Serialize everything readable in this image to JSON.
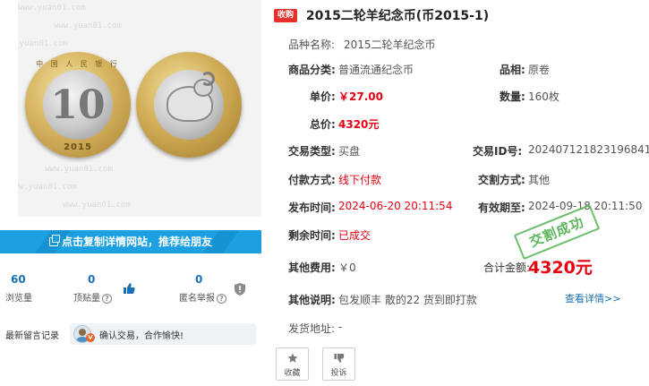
{
  "listing": {
    "badge": "收购",
    "title": "2015二轮羊纪念币(币2015-1)"
  },
  "fields": {
    "variety_label": "品种名称:",
    "variety_value": "2015二轮羊纪念币",
    "category_label": "商品分类:",
    "category_value": "普通流通纪念币",
    "grade_label": "品相:",
    "grade_value": "原卷",
    "unit_price_label": "单价:",
    "unit_price_value": "￥27.00",
    "quantity_label": "数量:",
    "quantity_value": "160枚",
    "total_label": "总价:",
    "total_value": "4320元",
    "trade_type_label": "交易类型:",
    "trade_type_value": "买盘",
    "trade_id_label": "交易ID号:",
    "trade_id_value": "202407121823196841",
    "payment_label": "付款方式:",
    "payment_value": "线下付款",
    "delivery_method_label": "交割方式:",
    "delivery_method_value": "其他",
    "published_label": "发布时间:",
    "published_value": "2024-06-20 20:11:54",
    "expires_label": "有效期至:",
    "expires_value": "2024-09-18 20:11:50",
    "remaining_label": "剩余时间:",
    "remaining_value": "已成交",
    "other_fees_label": "其他费用:",
    "other_fees_value": "￥0",
    "grand_total_label": "合计金额:",
    "grand_total_value": "4320元",
    "notes_label": "其他说明:",
    "notes_value": "包发顺丰 散的22 货到即打款",
    "notes_link": "查看详情>>",
    "shipping_address_label": "发货地址:",
    "shipping_address_value": "-"
  },
  "stamp_text": "交割成功",
  "actions": {
    "favorite_label": "收藏",
    "report_label": "投诉"
  },
  "left_panel": {
    "share_label": "点击复制详情网站，推荐给朋友",
    "stats": {
      "views_value": "60",
      "views_label": "浏览量",
      "likes_value": "0",
      "likes_label": "顶贴量",
      "reports_value": "0",
      "reports_label": "匿名举报"
    },
    "comments_label": "最新留言记录",
    "latest_comment": "确认交易，合作愉快!",
    "avatar_badge": "V",
    "coin_obverse_numeral": "10",
    "coin_obverse_year": "2015",
    "coin_obverse_ring": "中 国 人 民 银 行",
    "watermark": "www.yuan01.com"
  },
  "colors": {
    "accent_blue": "#1ca0e2",
    "price_red": "#e60012",
    "stamp_green": "#4cae4c",
    "link_blue": "#1a6fb5"
  },
  "icons": [
    "copy-icon",
    "question-icon",
    "thumbs-up-icon",
    "shield-icon",
    "star-icon",
    "thumbs-down-icon",
    "avatar"
  ]
}
